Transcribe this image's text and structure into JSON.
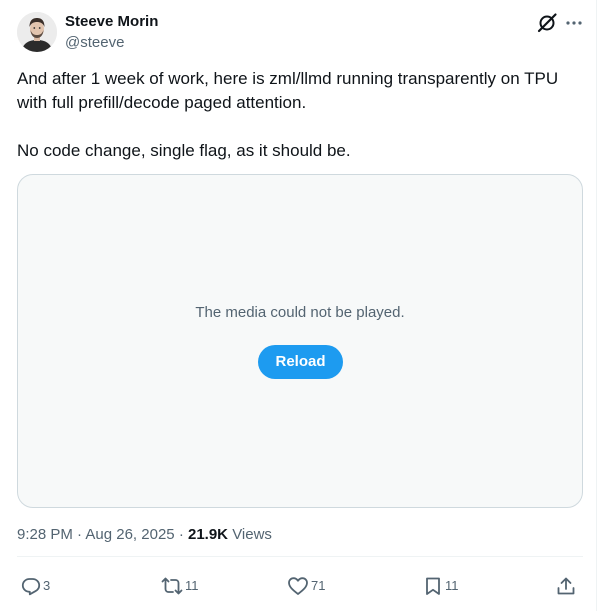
{
  "author": {
    "name": "Steeve Morin",
    "handle": "@steeve"
  },
  "tweet": {
    "paragraphs": [
      "And after 1 week of work, here is zml/llmd running transparently on TPU with full prefill/decode paged attention.",
      "No code change, single flag, as it should be."
    ]
  },
  "media": {
    "error_message": "The media could not be played.",
    "reload_label": "Reload"
  },
  "meta": {
    "time": "9:28 PM",
    "separator": "·",
    "date": "Aug 26, 2025",
    "views_count": "21.9K",
    "views_label": "Views"
  },
  "actions": {
    "replies": "3",
    "reposts": "11",
    "likes": "71",
    "bookmarks": "11"
  },
  "colors": {
    "accent": "#1d9bf0",
    "text_primary": "#0f1419",
    "text_secondary": "#536471",
    "media_bg": "#f7f9f9",
    "border": "#cfd9de"
  },
  "icons": {
    "avatar": "avatar-photo",
    "grok": "grok-icon",
    "more": "more-icon",
    "reply": "reply-icon",
    "repost": "repost-icon",
    "like": "heart-icon",
    "bookmark": "bookmark-icon",
    "share": "share-icon"
  }
}
